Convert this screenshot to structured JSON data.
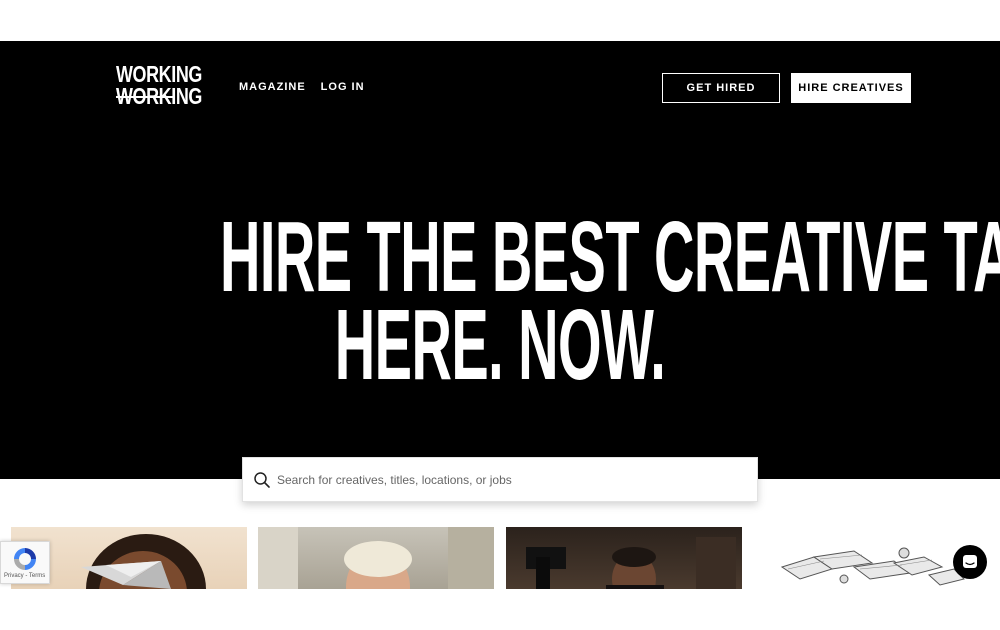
{
  "brand": {
    "logo_line1": "WORKING",
    "logo_line2": "WORKING"
  },
  "nav": {
    "items": [
      {
        "label": "MAGAZINE"
      },
      {
        "label": "LOG IN"
      }
    ]
  },
  "header_buttons": {
    "get_hired": "GET HIRED",
    "hire_creatives": "HIRE CREATIVES"
  },
  "hero": {
    "headline_line1": "HIRE THE BEST CREATIVE TALENT.",
    "headline_line2": "HERE. NOW."
  },
  "search": {
    "placeholder": "Search for creatives, titles, locations, or jobs",
    "value": ""
  },
  "recaptcha": {
    "text": "Privacy - Terms"
  },
  "icons": {
    "search": "search-icon",
    "recaptcha": "recaptcha-icon",
    "chat": "chat-icon"
  },
  "colors": {
    "hero_background": "#000000",
    "text_on_dark": "#ffffff",
    "button_solid_background": "#ffffff"
  }
}
